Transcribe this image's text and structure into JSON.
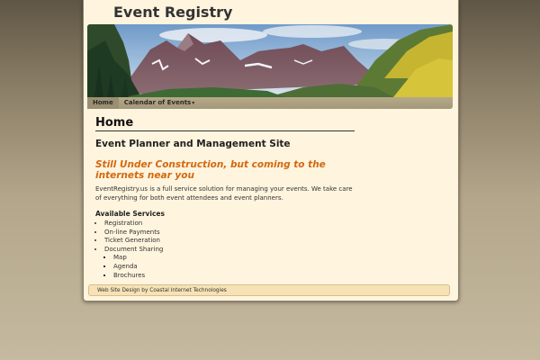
{
  "site": {
    "title": "Event Registry"
  },
  "nav": {
    "items": [
      {
        "label": "Home"
      },
      {
        "label": "Calendar of Events"
      }
    ]
  },
  "main": {
    "heading": "Home",
    "subheading": "Event Planner and Management Site",
    "notice": "Still Under Construction, but coming to the internets near you",
    "intro": "EventRegistry.us is a full service solution for managing your events. We take care of everything for both event attendees and event planners.",
    "services_heading": "Available Services",
    "services": [
      "Registration",
      "On-line Payments",
      "Ticket Generation",
      "Document Sharing"
    ],
    "document_sharing_items": [
      "Map",
      "Agenda",
      "Brochures"
    ]
  },
  "footer": {
    "prefix": "Web Site Design by ",
    "link": "Coastal Internet Technologies"
  },
  "colors": {
    "accent": "#d2690f",
    "page_bg": "#fff4de",
    "nav_bg": "#a89c7e"
  }
}
